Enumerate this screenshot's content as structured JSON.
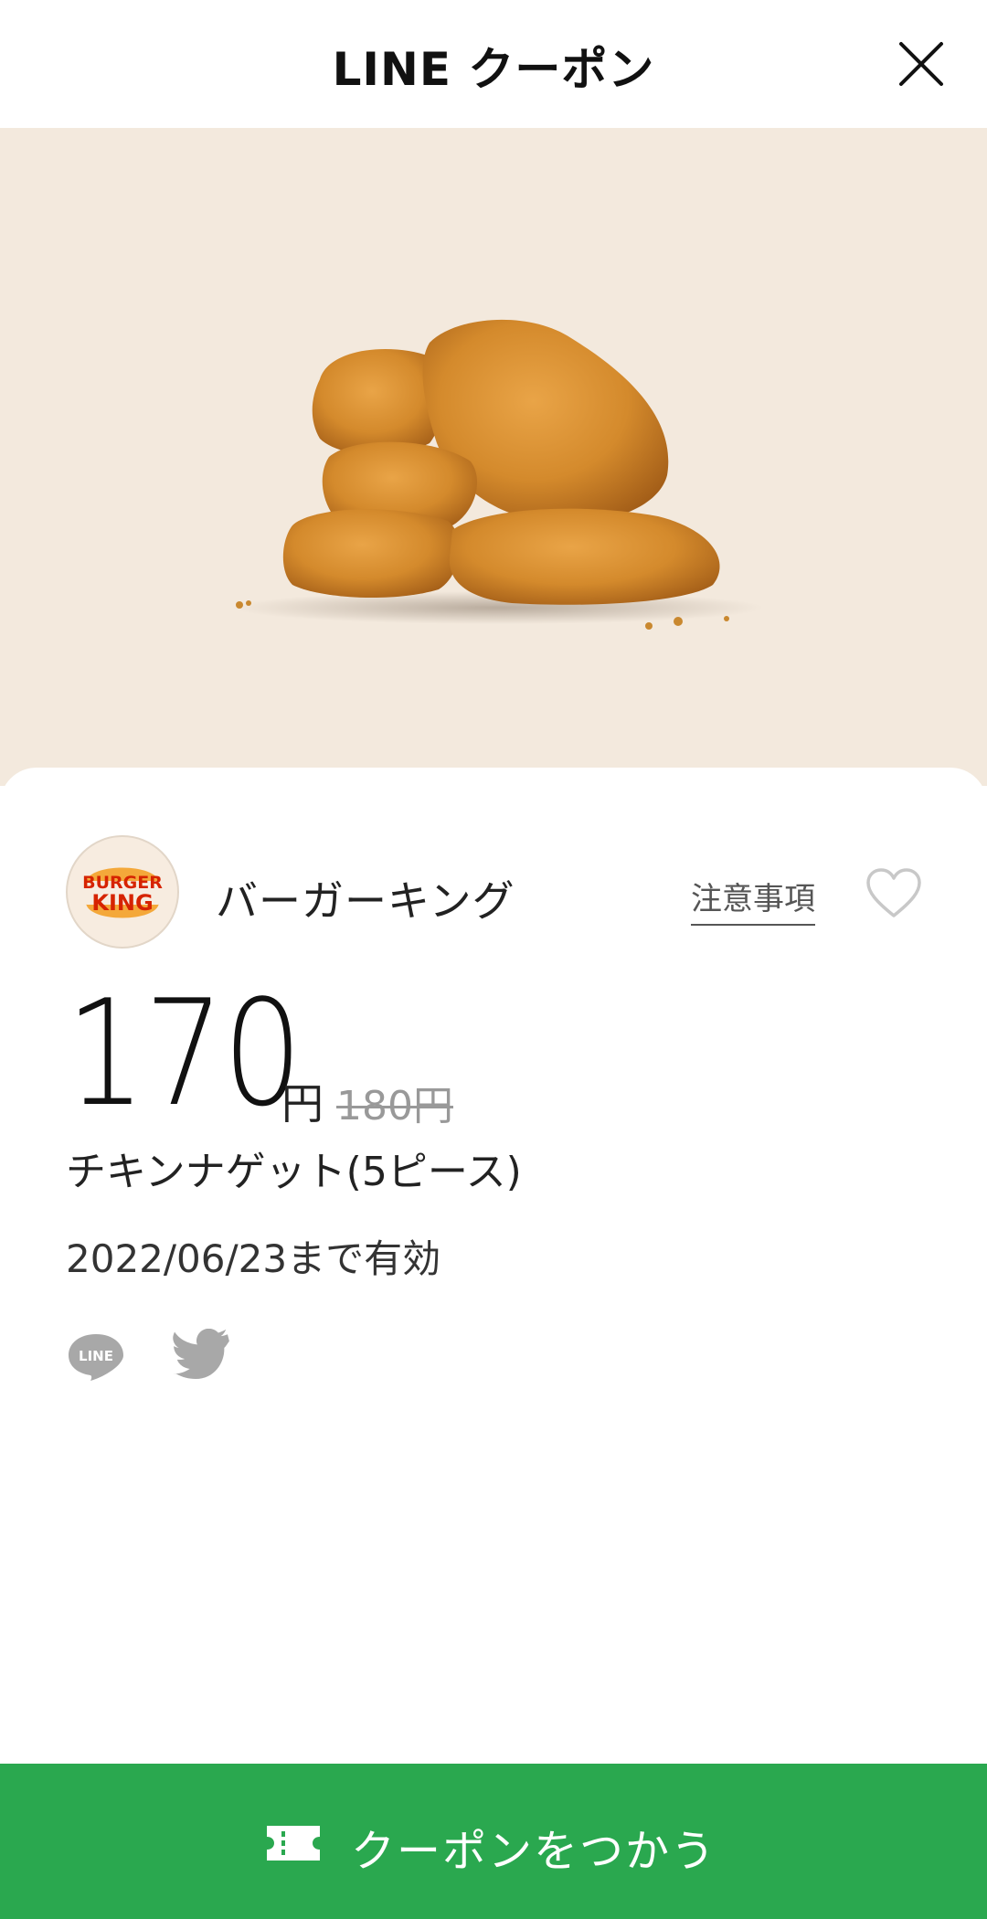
{
  "header": {
    "title": "LINE クーポン"
  },
  "brand": {
    "name": "バーガーキング",
    "logo_text_top": "BURGER",
    "logo_text_bottom": "KING"
  },
  "links": {
    "notes": "注意事項"
  },
  "price": {
    "current": "170",
    "unit": "円",
    "original": "180円"
  },
  "product": {
    "name": "チキンナゲット(5ピース)"
  },
  "validity": {
    "text": "2022/06/23まで有効"
  },
  "share": {
    "line_label": "LINE"
  },
  "cta": {
    "label": "クーポンをつかう"
  },
  "icons": {
    "close": "close-icon",
    "favorite": "heart-icon",
    "line": "line-icon",
    "twitter": "twitter-icon",
    "ticket": "ticket-icon"
  },
  "colors": {
    "cta_green": "#2aa84f",
    "hero_bg": "#f3e9dd",
    "logo_orange": "#f05a22",
    "logo_bun": "#f4a83a"
  }
}
